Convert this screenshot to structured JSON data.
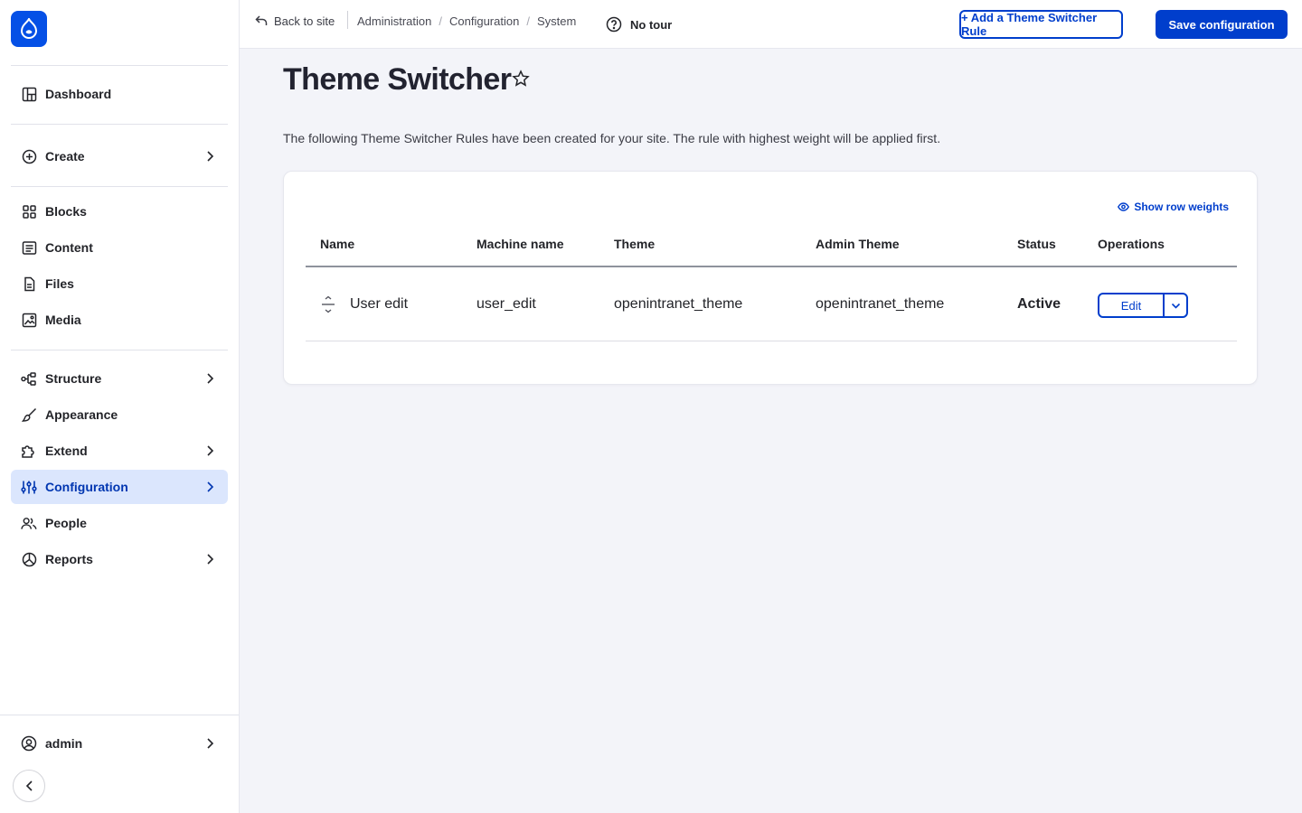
{
  "brand": {
    "logo_icon": "drupal-drop-icon",
    "accent": "#003ecc"
  },
  "sidebar": {
    "items": [
      {
        "label": "Dashboard",
        "icon": "dashboard-icon"
      },
      {
        "label": "Create",
        "icon": "plus-circle-icon"
      },
      {
        "label": "Blocks",
        "icon": "blocks-icon"
      },
      {
        "label": "Content",
        "icon": "content-icon"
      },
      {
        "label": "Files",
        "icon": "file-icon"
      },
      {
        "label": "Media",
        "icon": "media-icon"
      },
      {
        "label": "Structure",
        "icon": "structure-icon"
      },
      {
        "label": "Appearance",
        "icon": "brush-icon"
      },
      {
        "label": "Extend",
        "icon": "puzzle-icon"
      },
      {
        "label": "Configuration",
        "icon": "sliders-icon"
      },
      {
        "label": "People",
        "icon": "people-icon"
      },
      {
        "label": "Reports",
        "icon": "chart-pie-icon"
      }
    ],
    "user": {
      "label": "admin",
      "icon": "user-circle-icon"
    }
  },
  "topbar": {
    "back_label": "Back to site",
    "breadcrumb": [
      "Administration",
      "Configuration",
      "System"
    ],
    "tour_label": "No tour",
    "add_rule_label": "+ Add a Theme Switcher Rule",
    "save_label": "Save configuration"
  },
  "page": {
    "title": "Theme Switcher",
    "description": "The following Theme Switcher Rules have been created for your site. The rule with highest weight will be applied first.",
    "show_weights_label": "Show row weights"
  },
  "table": {
    "headers": [
      "Name",
      "Machine name",
      "Theme",
      "Admin Theme",
      "Status",
      "Operations"
    ],
    "rows": [
      {
        "name": "User edit",
        "machine_name": "user_edit",
        "theme": "openintranet_theme",
        "admin_theme": "openintranet_theme",
        "status": "Active",
        "operation": "Edit"
      }
    ]
  }
}
